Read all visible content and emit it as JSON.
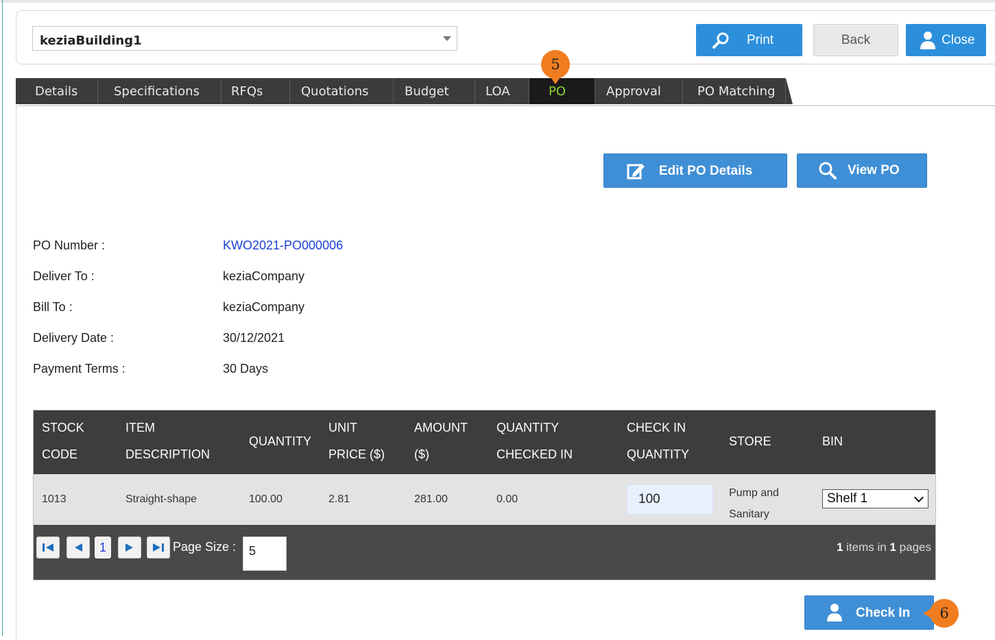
{
  "header": {
    "building_select": "keziaBuilding1",
    "print_label": "Print",
    "back_label": "Back",
    "close_label": "Close"
  },
  "tabs": [
    {
      "label": "Details"
    },
    {
      "label": "Specifications"
    },
    {
      "label": "RFQs"
    },
    {
      "label": "Quotations"
    },
    {
      "label": "Budget"
    },
    {
      "label": "LOA"
    },
    {
      "label": "PO",
      "active": true
    },
    {
      "label": "Approval"
    },
    {
      "label": "PO Matching"
    }
  ],
  "actions": {
    "edit_po_label": "Edit PO Details",
    "view_po_label": "View PO"
  },
  "po_info": [
    {
      "label": "PO Number :",
      "value": "KWO2021-PO000006"
    },
    {
      "label": "Deliver To :",
      "value": "keziaCompany"
    },
    {
      "label": "Bill To :",
      "value": "keziaCompany"
    },
    {
      "label": "Delivery Date :",
      "value": "30/12/2021"
    },
    {
      "label": "Payment Terms :",
      "value": "30 Days"
    }
  ],
  "grid": {
    "columns": [
      {
        "line1": "STOCK",
        "line2": "CODE"
      },
      {
        "line1": "ITEM",
        "line2": "DESCRIPTION"
      },
      {
        "line1": "QUANTITY",
        "line2": ""
      },
      {
        "line1": "UNIT",
        "line2": "PRICE ($)"
      },
      {
        "line1": "AMOUNT",
        "line2": "($)"
      },
      {
        "line1": "QUANTITY",
        "line2": "CHECKED IN"
      },
      {
        "line1": "CHECK IN",
        "line2": "QUANTITY"
      },
      {
        "line1": "STORE",
        "line2": ""
      },
      {
        "line1": "BIN",
        "line2": ""
      }
    ],
    "rows": [
      {
        "stock_code": "1013",
        "description": "Straight-shape",
        "quantity": "100.00",
        "unit_price": "2.81",
        "amount": "281.00",
        "qty_checked_in": "0.00",
        "check_in_qty": "100",
        "store_line1": "Pump and",
        "store_line2": "Sanitary",
        "bin": "Shelf 1"
      }
    ],
    "pager": {
      "current_page": "1",
      "page_size_label": "Page Size :",
      "page_size": "5",
      "items_count": "1",
      "items_text": "items in",
      "pages_count": "1",
      "pages_text": "pages"
    }
  },
  "check_in_label": "Check In",
  "annotations": {
    "step5": "5",
    "step6": "6"
  },
  "colors": {
    "primary_blue": "#2b8fdc",
    "tab_dark": "#3b3b3b",
    "tab_active_text": "#8dd433",
    "grid_header": "#3d3d3d",
    "badge_orange": "#f07d1f",
    "link_blue": "#1a3fd6"
  },
  "icons": {
    "print": "magnifier-icon",
    "close": "user-icon",
    "edit": "edit-icon",
    "view": "search-icon",
    "check_in": "user-icon"
  }
}
